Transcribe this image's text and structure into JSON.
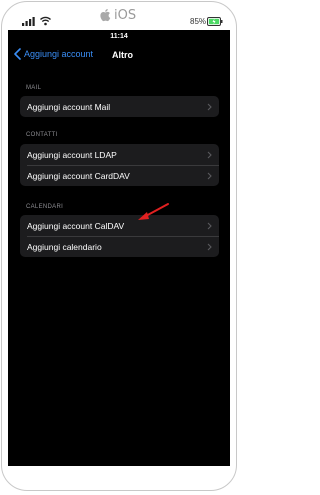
{
  "frame": {
    "logo_text": "iOS",
    "battery_percent": "85%"
  },
  "status": {
    "time": "11:14"
  },
  "nav": {
    "back_label": "Aggiungi account",
    "title": "Altro"
  },
  "sections": [
    {
      "header": "MAIL",
      "rows": [
        "Aggiungi account Mail"
      ]
    },
    {
      "header": "CONTATTI",
      "rows": [
        "Aggiungi account LDAP",
        "Aggiungi account CardDAV"
      ]
    },
    {
      "header": "CALENDARI",
      "rows": [
        "Aggiungi account CalDAV",
        "Aggiungi calendario"
      ]
    }
  ],
  "colors": {
    "accent": "#3a8ef6",
    "annotation_arrow": "#e02020",
    "background": "#000000",
    "cell": "#1c1c1e"
  }
}
